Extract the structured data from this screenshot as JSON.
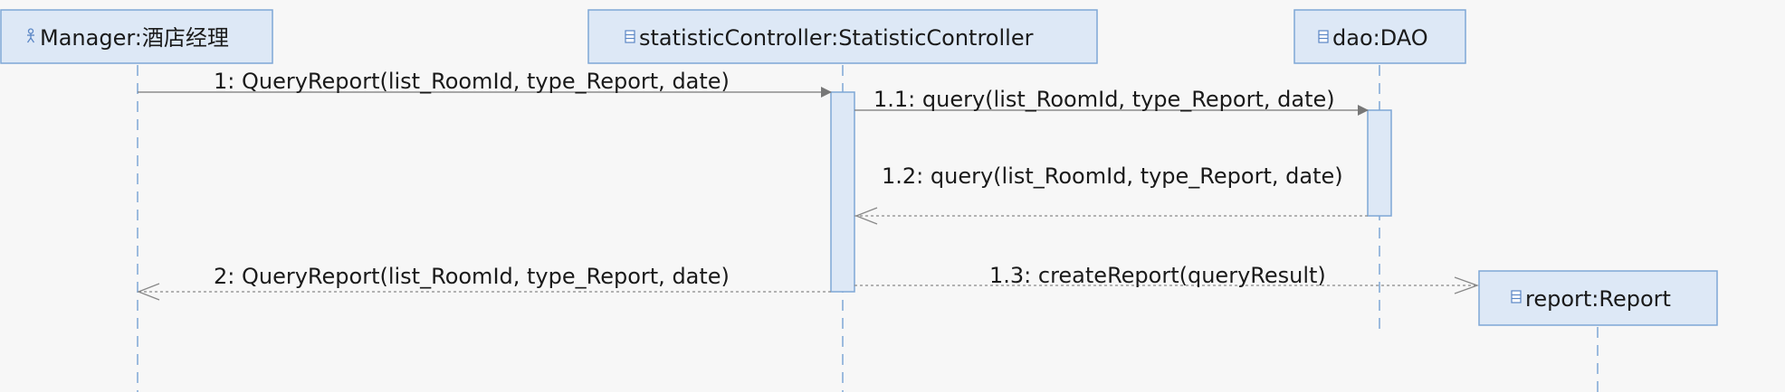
{
  "diagram": {
    "lifelines": [
      {
        "id": "manager",
        "name": "Manager:酒店经理",
        "icon": "actor-icon"
      },
      {
        "id": "controller",
        "name": "statisticController:StatisticController",
        "icon": "class-icon"
      },
      {
        "id": "dao",
        "name": "dao:DAO",
        "icon": "class-icon"
      },
      {
        "id": "report",
        "name": "report:Report",
        "icon": "class-icon"
      }
    ],
    "messages": [
      {
        "id": "m1",
        "label": "1: QueryReport(list_RoomId, type_Report, date)",
        "kind": "sync"
      },
      {
        "id": "m11",
        "label": "1.1: query(list_RoomId, type_Report, date)",
        "kind": "sync"
      },
      {
        "id": "m12",
        "label": "1.2: query(list_RoomId, type_Report, date)",
        "kind": "return"
      },
      {
        "id": "m13",
        "label": "1.3: createReport(queryResult)",
        "kind": "create"
      },
      {
        "id": "m2",
        "label": "2: QueryReport(list_RoomId, type_Report, date)",
        "kind": "return"
      }
    ],
    "colors": {
      "box_fill": "#dde8f6",
      "box_stroke": "#7fa7d6",
      "lifeline": "#7fa7d6",
      "arrow": "#777777",
      "text": "#1a1a1a"
    }
  }
}
